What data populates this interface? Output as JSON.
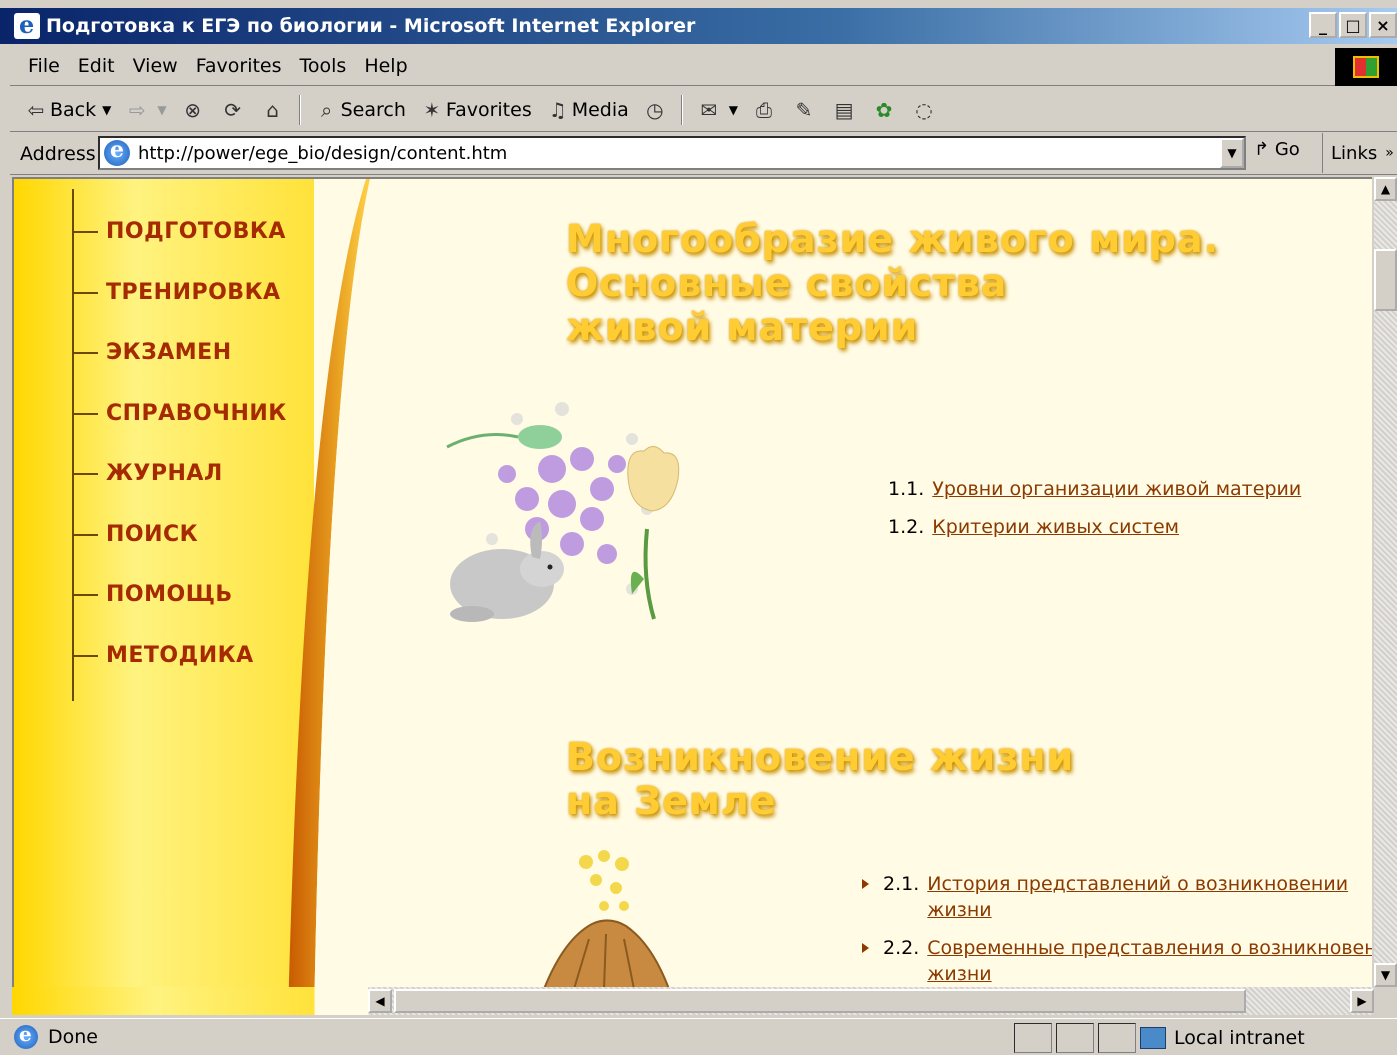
{
  "window": {
    "title": "Подготовка к ЕГЭ по биологии - Microsoft Internet Explorer",
    "controls": [
      "_",
      "□",
      "×"
    ]
  },
  "menu": [
    "File",
    "Edit",
    "View",
    "Favorites",
    "Tools",
    "Help"
  ],
  "toolbar": {
    "back": "Back",
    "search": "Search",
    "favorites": "Favorites",
    "media": "Media"
  },
  "address": {
    "label": "Address",
    "url": "http://power/ege_bio/design/content.htm",
    "go": "Go",
    "links": "Links"
  },
  "nav": [
    "ПОДГОТОВКА",
    "ТРЕНИРОВКА",
    "ЭКЗАМЕН",
    "СПРАВОЧНИК",
    "ЖУРНАЛ",
    "ПОИСК",
    "ПОМОЩЬ",
    "МЕТОДИКА"
  ],
  "section1": {
    "title_lines": [
      "Многообразие живого мира.",
      "Основные свойства",
      "живой материи"
    ],
    "items": [
      {
        "num": "1.1.",
        "text": "Уровни организации живой материи"
      },
      {
        "num": "1.2.",
        "text": "Критерии живых систем"
      }
    ]
  },
  "section2": {
    "title_lines": [
      "Возникновение жизни",
      "на Земле"
    ],
    "items": [
      {
        "num": "2.1.",
        "text": "История представлений о возникновении",
        "cont": "жизни"
      },
      {
        "num": "2.2.",
        "text": "Современные представления о возникновении",
        "cont": "жизни"
      }
    ]
  },
  "status": {
    "text": "Done",
    "zone": "Local intranet"
  },
  "colors": {
    "nav_text": "#a52a00",
    "link": "#8b3a00",
    "heading": "#ffcc33",
    "page_bg": "#fffbe5"
  }
}
